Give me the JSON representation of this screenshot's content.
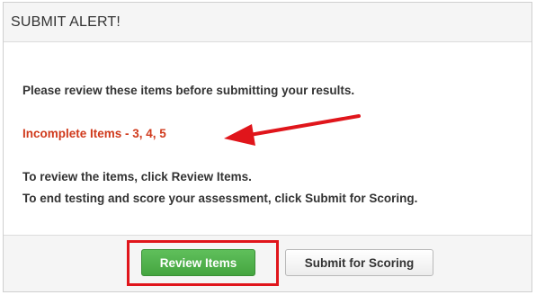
{
  "dialog": {
    "title": "SUBMIT ALERT!",
    "message_review": "Please review these items before submitting your results.",
    "incomplete_text": "Incomplete Items - 3, 4, 5",
    "instruction_review": "To review the items, click Review Items.",
    "instruction_submit": "To end testing and score your assessment, click Submit for Scoring."
  },
  "buttons": {
    "review_label": "Review Items",
    "submit_label": "Submit for Scoring"
  },
  "colors": {
    "incomplete_text": "#d03a1c",
    "annotation_red": "#e0151b",
    "review_button": "#4caf50"
  },
  "annotations": {
    "arrow_icon": "red-arrow-icon",
    "highlight": "red-highlight-box"
  }
}
